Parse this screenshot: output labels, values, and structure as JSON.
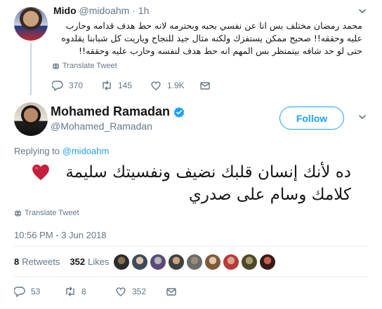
{
  "reply_tweet": {
    "name": "Mido",
    "handle": "@midoahm",
    "dot": "·",
    "time": "1h",
    "text": "محمد رمضان مختلف بس انا عن نفسي بحبه وبحترمه لانه حط هدف قدامه وحارب عليه وحققه!! صحيح ممكن يستفزك ولكنه مثال جيد للنجاح وياريت كل شبابنا يقلدوه حتى لو حد شافه بيتمنظر بس المهم انه حط هدف لنفسه وحارب عليه وحققه!!",
    "translate": "Translate Tweet",
    "replies": "370",
    "retweets": "145",
    "likes": "1.9K"
  },
  "main_tweet": {
    "name": "Mohamed Ramadan",
    "handle": "@Mohamed_Ramadan",
    "follow_label": "Follow",
    "replying_prefix": "Replying to ",
    "replying_handle": "@midoahm",
    "text_line1": "ده لأنك إنسان قلبك نضيف ونفسيتك سليمة",
    "text_line2": "كلامك وسام على صدري",
    "emoji": "red-heart",
    "translate": "Translate Tweet",
    "timestamp": "10:56 PM - 3 Jun 2018",
    "retweets_count": "8",
    "retweets_label": "Retweets",
    "likes_count": "352",
    "likes_label": "Likes",
    "action_replies": "53",
    "action_retweets": "8",
    "action_likes": "352"
  },
  "colors": {
    "accent": "#1da1f2",
    "muted": "#657786",
    "heart": "#e0245e"
  }
}
